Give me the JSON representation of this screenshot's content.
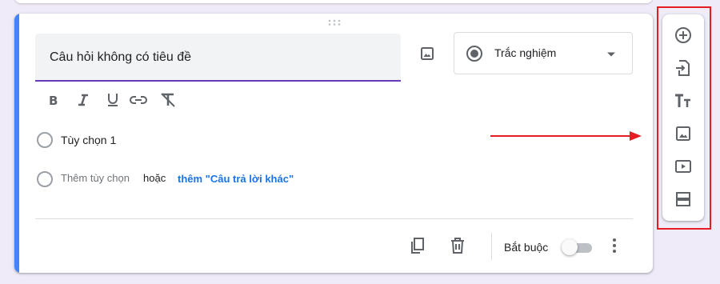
{
  "question": {
    "title_placeholder": "Câu hỏi không có tiêu đề",
    "type_selected": "Trắc nghiệm",
    "options": [
      {
        "label": "Tùy chọn 1"
      }
    ],
    "add_option_label": "Thêm tùy chọn",
    "or_label": "hoặc",
    "add_other_label": "thêm \"Câu trả lời khác\""
  },
  "formatting_toolbar": {
    "icons": [
      "bold-icon",
      "italic-icon",
      "underline-icon",
      "link-icon",
      "clear-format-icon"
    ]
  },
  "footer": {
    "required_label": "Bắt buộc",
    "required_on": false
  },
  "side_toolbar": {
    "icons": [
      "add-question-icon",
      "import-questions-icon",
      "add-title-icon",
      "add-image-icon",
      "add-video-icon",
      "add-section-icon"
    ]
  },
  "colors": {
    "accent": "#4285f4",
    "underline": "#673ab7",
    "link": "#1a73e8",
    "background": "#f0ebf8",
    "annotation": "#e51c23"
  }
}
